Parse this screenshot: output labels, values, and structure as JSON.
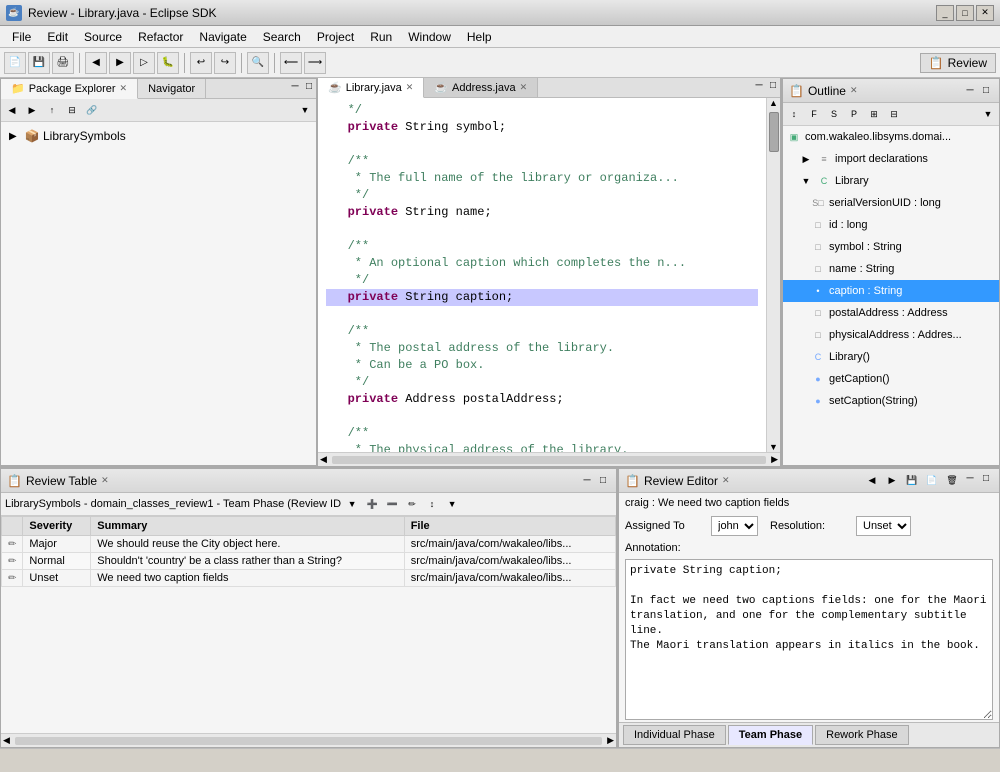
{
  "window": {
    "title": "Review - Library.java - Eclipse SDK",
    "icon": "☕"
  },
  "menu": {
    "items": [
      "File",
      "Edit",
      "Source",
      "Refactor",
      "Navigate",
      "Search",
      "Project",
      "Run",
      "Window",
      "Help"
    ]
  },
  "toolbar": {
    "review_label": "Review"
  },
  "left_panel": {
    "tabs": [
      {
        "label": "Package Explorer",
        "active": true
      },
      {
        "label": "Navigator",
        "active": false
      }
    ],
    "tree": {
      "root": "LibrarySymbols"
    }
  },
  "editor": {
    "tabs": [
      {
        "label": "Library.java",
        "active": true
      },
      {
        "label": "Address.java",
        "active": false
      }
    ],
    "code_lines": [
      {
        "num": "",
        "text": "*/",
        "type": "normal"
      },
      {
        "num": "",
        "text": "private String symbol;",
        "type": "keyword-line"
      },
      {
        "num": "",
        "text": "",
        "type": "normal"
      },
      {
        "num": "",
        "text": "/**",
        "type": "comment"
      },
      {
        "num": "",
        "text": " * The full name of the library or organiza...",
        "type": "comment"
      },
      {
        "num": "",
        "text": " */",
        "type": "comment"
      },
      {
        "num": "",
        "text": "private String name;",
        "type": "keyword-line"
      },
      {
        "num": "",
        "text": "",
        "type": "normal"
      },
      {
        "num": "",
        "text": "/**",
        "type": "comment"
      },
      {
        "num": "",
        "text": " * An optional caption which completes the n...",
        "type": "comment"
      },
      {
        "num": "",
        "text": " */",
        "type": "comment"
      },
      {
        "num": "",
        "text": "private String caption;",
        "type": "keyword-highlight"
      },
      {
        "num": "",
        "text": "",
        "type": "normal"
      },
      {
        "num": "",
        "text": "/**",
        "type": "comment"
      },
      {
        "num": "",
        "text": " * The postal address of the library.",
        "type": "comment"
      },
      {
        "num": "",
        "text": " * Can be a PO box.",
        "type": "comment"
      },
      {
        "num": "",
        "text": " */",
        "type": "comment"
      },
      {
        "num": "",
        "text": "private Address postalAddress;",
        "type": "keyword-line"
      },
      {
        "num": "",
        "text": "",
        "type": "normal"
      },
      {
        "num": "",
        "text": "/**",
        "type": "comment"
      },
      {
        "num": "",
        "text": " * The physical address of the library.",
        "type": "comment"
      }
    ]
  },
  "outline": {
    "title": "Outline",
    "items": [
      {
        "label": "com.wakaleo.libsyms.domai...",
        "level": 0,
        "icon": "pkg",
        "selected": false
      },
      {
        "label": "import declarations",
        "level": 1,
        "icon": "imp",
        "selected": false
      },
      {
        "label": "Library",
        "level": 1,
        "icon": "cls",
        "selected": false
      },
      {
        "label": "serialVersionUID : long",
        "level": 2,
        "icon": "field",
        "selected": false
      },
      {
        "label": "id : long",
        "level": 2,
        "icon": "field",
        "selected": false
      },
      {
        "label": "symbol : String",
        "level": 2,
        "icon": "field",
        "selected": false
      },
      {
        "label": "name : String",
        "level": 2,
        "icon": "field",
        "selected": false
      },
      {
        "label": "caption : String",
        "level": 2,
        "icon": "field",
        "selected": true
      },
      {
        "label": "postalAddress : Address",
        "level": 2,
        "icon": "field",
        "selected": false
      },
      {
        "label": "physicalAddress : Addres...",
        "level": 2,
        "icon": "field",
        "selected": false
      },
      {
        "label": "Library()",
        "level": 2,
        "icon": "method",
        "selected": false
      },
      {
        "label": "getCaption()",
        "level": 2,
        "icon": "method",
        "selected": false
      },
      {
        "label": "setCaption(String)",
        "level": 2,
        "icon": "method",
        "selected": false
      }
    ]
  },
  "review_table": {
    "title": "Review Table",
    "header_label": "LibrarySymbols - domain_classes_review1 - Team Phase (Review ID",
    "columns": [
      "",
      "Severity",
      "Summary",
      "File"
    ],
    "rows": [
      {
        "icon": "✏",
        "severity": "Major",
        "summary": "We should reuse the City object here.",
        "file": "src/main/java/com/wakaleo/libs..."
      },
      {
        "icon": "✏",
        "severity": "Normal",
        "summary": "Shouldn't 'country' be a class rather than a String?",
        "file": "src/main/java/com/wakaleo/libs..."
      },
      {
        "icon": "✏",
        "severity": "Unset",
        "summary": "We need two caption fields",
        "file": "src/main/java/com/wakaleo/libs..."
      }
    ]
  },
  "review_editor": {
    "title": "Review Editor",
    "header_title": "craig : We need two caption fields",
    "assigned_to_label": "Assigned To",
    "assigned_to_value": "john",
    "resolution_label": "Resolution:",
    "resolution_value": "Unset",
    "annotation_label": "Annotation:",
    "annotation_text": "private String caption;\n\nIn fact we need two captions fields: one for the Maori\ntranslation, and one for the complementary subtitle line.\nThe Maori translation appears in italics in the book.",
    "phases": [
      "Individual Phase",
      "Team Phase",
      "Rework Phase"
    ],
    "active_phase": "Team Phase"
  },
  "status_bar": {
    "text": ""
  }
}
